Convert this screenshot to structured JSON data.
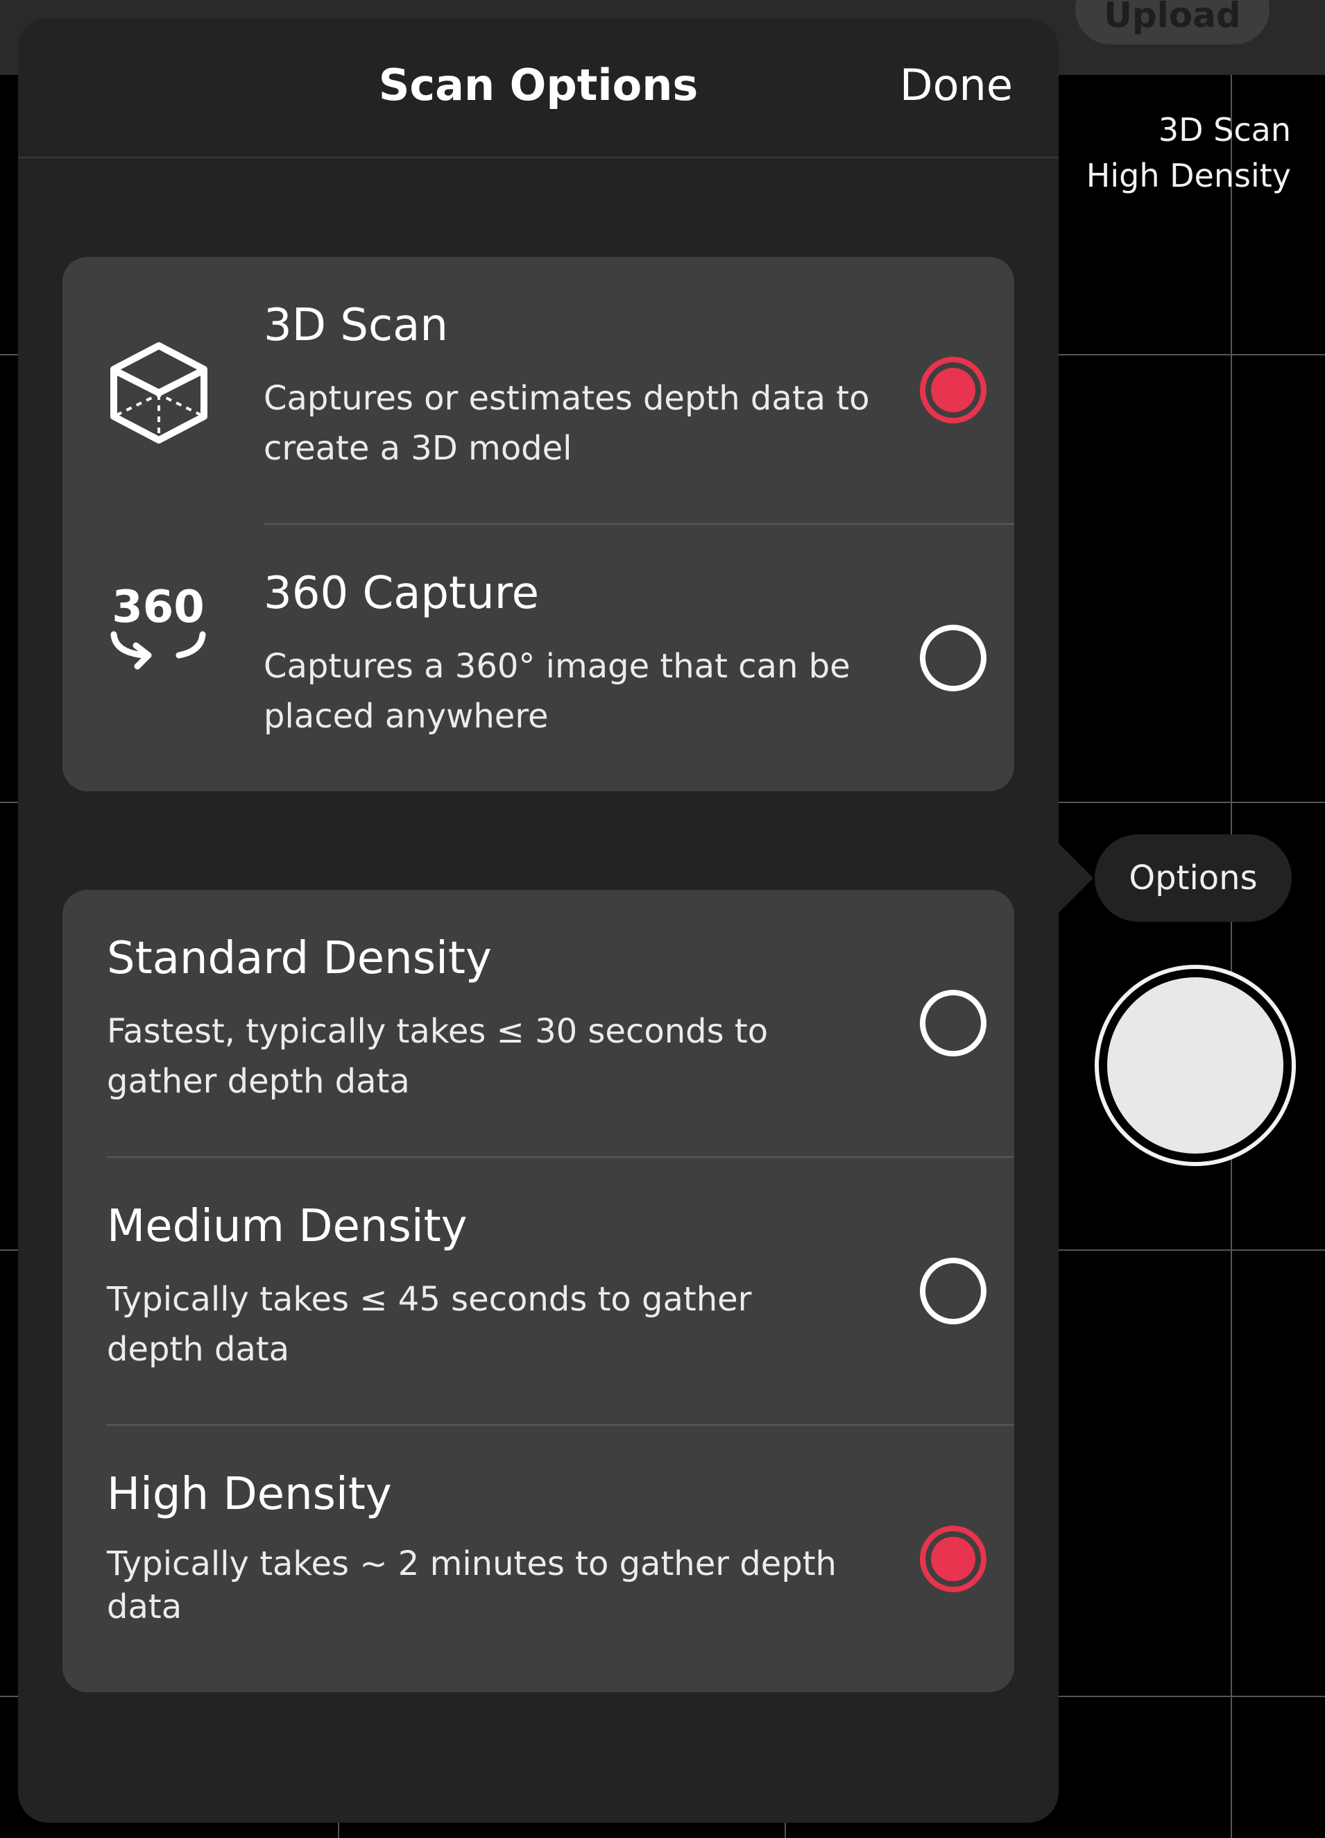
{
  "background": {
    "upload_label": "Upload",
    "mode_line1": "3D Scan",
    "mode_line2": "High Density",
    "options_label": "Options"
  },
  "popover": {
    "title": "Scan Options",
    "done_label": "Done"
  },
  "capture_types": [
    {
      "title": "3D Scan",
      "description": "Captures or estimates depth data to create a 3D model",
      "icon": "cube-icon",
      "selected": true
    },
    {
      "title": "360 Capture",
      "description": "Captures a 360° image that can be placed anywhere",
      "icon": "360-icon",
      "icon_text": "360",
      "selected": false
    }
  ],
  "densities": [
    {
      "title": "Standard Density",
      "description": "Fastest, typically takes ≤ 30 seconds to gather depth data",
      "selected": false
    },
    {
      "title": "Medium Density",
      "description": "Typically takes ≤ 45 seconds to gather depth data",
      "selected": false
    },
    {
      "title": "High Density",
      "description": "Typically takes ~ 2 minutes to gather depth data",
      "selected": true
    }
  ],
  "colors": {
    "accent": "#E8344E",
    "card": "#3F3F3F",
    "sheet": "#232323"
  }
}
